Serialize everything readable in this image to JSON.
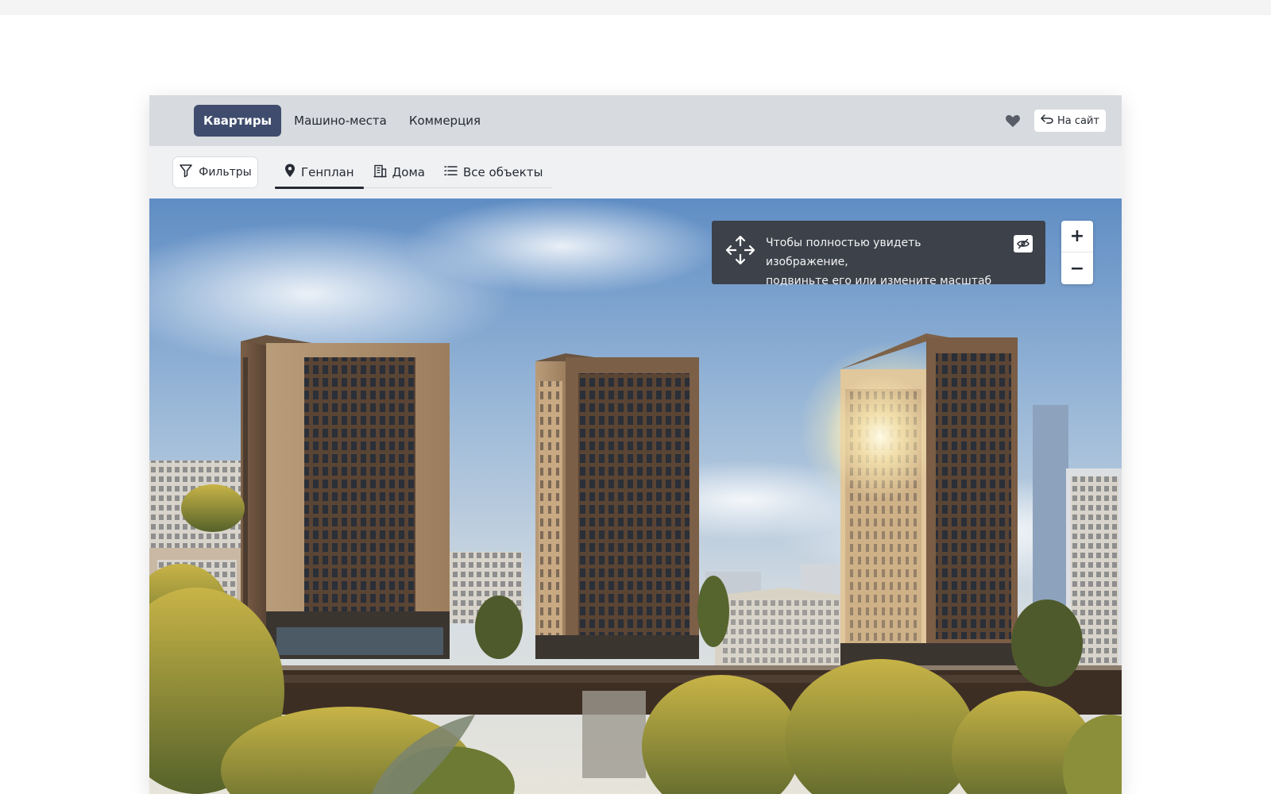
{
  "topbar": {
    "tabs": [
      {
        "label": "Квартиры",
        "active": true
      },
      {
        "label": "Машино-места",
        "active": false
      },
      {
        "label": "Коммерция",
        "active": false
      }
    ],
    "favorites_icon": "heart-icon",
    "site_button": {
      "label": "На сайт",
      "icon": "return-arrow-icon"
    }
  },
  "subbar": {
    "filters": {
      "label": "Фильтры",
      "icon": "funnel-icon"
    },
    "view_tabs": [
      {
        "label": "Генплан",
        "icon": "map-pin-icon",
        "active": true
      },
      {
        "label": "Дома",
        "icon": "building-icon",
        "active": false
      },
      {
        "label": "Все объекты",
        "icon": "list-icon",
        "active": false
      }
    ]
  },
  "viewport": {
    "hint": {
      "line1": "Чтобы полностью увидеть изображение,",
      "line2": "подвиньте его или измените масштаб",
      "move_icon": "move-arrows-icon",
      "hide_icon": "eye-off-icon"
    },
    "zoom": {
      "in_label": "+",
      "out_label": "−"
    }
  },
  "colors": {
    "accent": "#3f4c6e",
    "topbar": "#d7dade",
    "hint_bg": "#3d4149"
  }
}
